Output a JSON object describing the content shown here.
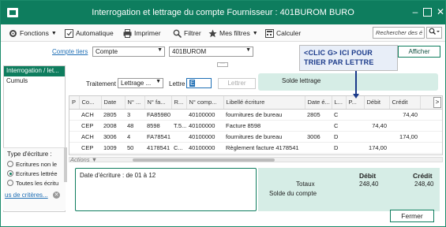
{
  "window": {
    "title": "Interrogation et lettrage du compte Fournisseur : 401BUROM BURO"
  },
  "toolbar": {
    "functions": "Fonctions",
    "automatique": "Automatique",
    "imprimer": "Imprimer",
    "filtrer": "Filtrer",
    "mes_filtres": "Mes filtres",
    "calculer": "Calculer",
    "search_placeholder": "Rechercher des é"
  },
  "filter": {
    "compte_tiers_label": "Compte tiers",
    "compte_select": "Compte",
    "compte_value": "401BUROM",
    "afficher": "Afficher"
  },
  "annotation": {
    "line1": "<CLIC G> ICI POUR",
    "line2": "TRIER PAR LETTRE"
  },
  "sidebar": {
    "items": [
      {
        "label": "Interrogation / let..."
      },
      {
        "label": "Cumuls"
      }
    ]
  },
  "type_ecriture": {
    "title": "Type d'écriture :",
    "options": [
      "Ecritures non le",
      "Ecritures lettrée",
      "Toutes les écritu"
    ],
    "selected": 1,
    "criteria_link": "us de critères..."
  },
  "treatment": {
    "label": "Traitement",
    "select_value": "Lettrage ...",
    "lettre_label": "Lettre",
    "lettre_value": "E",
    "lettrer_button": "Lettrer",
    "solde_lettrage": "Solde lettrage"
  },
  "grid": {
    "columns": [
      "P",
      "Co...",
      "Date",
      "N° ...",
      "N° fa...",
      "R...",
      "N° comp...",
      "Libellé écriture",
      "Date é...",
      "L...",
      "P...",
      "Débit",
      "Crédit"
    ],
    "rows": [
      [
        "",
        "ACH",
        "2805",
        "3",
        "FA85980",
        "",
        "40100000",
        "fournitures de bureau",
        "2805",
        "C",
        "",
        "",
        "74,40"
      ],
      [
        "",
        "CEP",
        "2008",
        "48",
        "8598",
        "T.5...",
        "40100000",
        "Facture 8598",
        "",
        "C",
        "",
        "74,40",
        ""
      ],
      [
        "",
        "ACH",
        "3006",
        "4",
        "FA78541",
        "",
        "40100000",
        "fournitures de bureau",
        "3006",
        "D",
        "",
        "",
        "174,00"
      ],
      [
        "",
        "CEP",
        "1009",
        "50",
        "4178541",
        "C...",
        "40100000",
        "Règlement facture 4178541",
        "",
        "D",
        "",
        "174,00",
        ""
      ]
    ],
    "nav_icon": ">",
    "actions_label": "Actions"
  },
  "footer": {
    "date_ecriture": "Date d'écriture : de 01 à 12",
    "debit_label": "Débit",
    "credit_label": "Crédit",
    "totaux_label": "Totaux",
    "totaux_debit": "248,40",
    "totaux_credit": "248,40",
    "solde_label": "Solde du compte",
    "fermer": "Fermer"
  }
}
